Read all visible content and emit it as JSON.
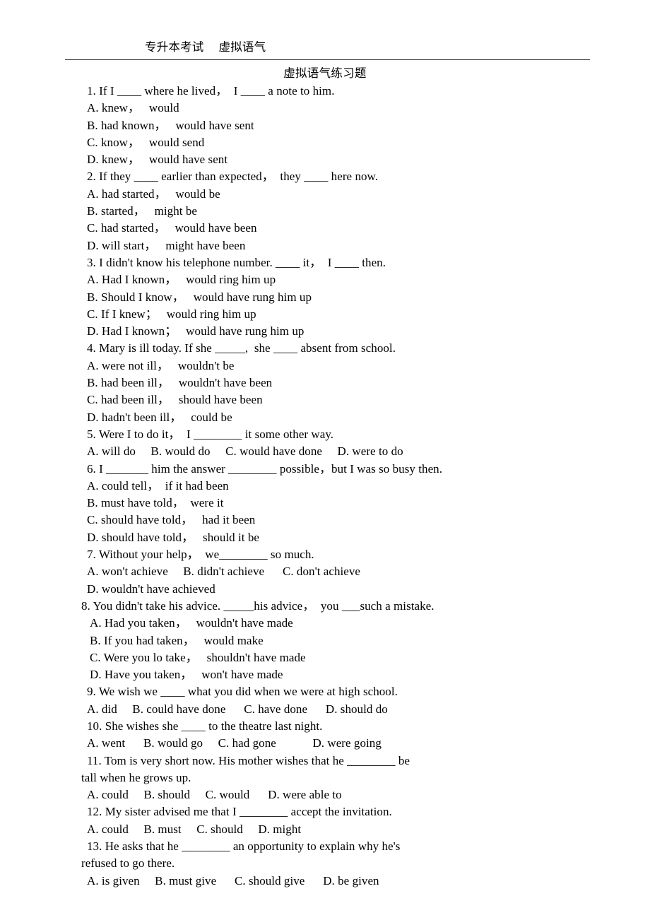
{
  "header": {
    "running_head": "专升本考试　 虚拟语气"
  },
  "title": "虚拟语气练习题",
  "lines": [
    {
      "id": "q1-stem",
      "text": "1. If I ____ where he lived，  I ____ a note to him."
    },
    {
      "id": "q1-a",
      "text": "A. knew，   would"
    },
    {
      "id": "q1-b",
      "text": "B. had known，   would have sent"
    },
    {
      "id": "q1-c",
      "text": "C. know，   would send"
    },
    {
      "id": "q1-d",
      "text": "D. knew，   would have sent"
    },
    {
      "id": "q2-stem",
      "text": "2. If they ____ earlier than expected，  they ____ here now."
    },
    {
      "id": "q2-a",
      "text": "A. had started，   would be"
    },
    {
      "id": "q2-b",
      "text": "B. started，   might be"
    },
    {
      "id": "q2-c",
      "text": "C. had started，   would have been"
    },
    {
      "id": "q2-d",
      "text": "D. will start，   might have been"
    },
    {
      "id": "q3-stem",
      "text": "3. I didn't know his telephone number. ____ it，  I ____ then."
    },
    {
      "id": "q3-a",
      "text": "A. Had I known，   would ring him up"
    },
    {
      "id": "q3-b",
      "text": "B. Should I know，   would have rung him up"
    },
    {
      "id": "q3-c",
      "text": "C. If I knew；   would ring him up"
    },
    {
      "id": "q3-d",
      "text": "D. Had I known；   would have rung him up"
    },
    {
      "id": "q4-stem",
      "text": "4. Mary is ill today. If she _____,  she ____ absent from school."
    },
    {
      "id": "q4-a",
      "text": "A. were not ill，   wouldn't be"
    },
    {
      "id": "q4-b",
      "text": "B. had been ill，   wouldn't have been"
    },
    {
      "id": "q4-c",
      "text": "C. had been ill，   should have been"
    },
    {
      "id": "q4-d",
      "text": "D. hadn't been ill，   could be"
    },
    {
      "id": "q5-stem",
      "text": "5. Were I to do it，  I ________ it some other way."
    },
    {
      "id": "q5-opts",
      "text": "A. will do     B. would do     C. would have done     D. were to do"
    },
    {
      "id": "q6-stem",
      "text": "6. I _______ him the answer ________ possible，but I was so busy then."
    },
    {
      "id": "q6-a",
      "text": "A. could tell，  if it had been"
    },
    {
      "id": "q6-b",
      "text": "B. must have told，  were it"
    },
    {
      "id": "q6-c",
      "text": "C. should have told，   had it been"
    },
    {
      "id": "q6-d",
      "text": "D. should have told，   should it be"
    },
    {
      "id": "q7-stem",
      "text": "7. Without your help，  we________ so much."
    },
    {
      "id": "q7-abc",
      "text": "A. won't achieve     B. didn't achieve      C. don't achieve"
    },
    {
      "id": "q7-d",
      "text": "D. wouldn't have achieved"
    },
    {
      "id": "q8-stem",
      "text": "8. You didn't take his advice. _____his advice，  you ___such a mistake."
    },
    {
      "id": "q8-a",
      "text": "A. Had you taken，   wouldn't have made"
    },
    {
      "id": "q8-b",
      "text": "B. If you had taken，   would make"
    },
    {
      "id": "q8-c",
      "text": "C. Were you lo take，   shouldn't have made"
    },
    {
      "id": "q8-d",
      "text": "D. Have you taken，   won't have made"
    },
    {
      "id": "q9-stem",
      "text": "9. We wish we ____ what you did when we were at high school."
    },
    {
      "id": "q9-opts",
      "text": "A. did     B. could have done      C. have done      D. should do"
    },
    {
      "id": "q10-stem",
      "text": "10. She wishes she ____ to the theatre last night."
    },
    {
      "id": "q10-opts",
      "text": "A. went      B. would go     C. had gone            D. were going"
    },
    {
      "id": "q11-stem",
      "text": "11. Tom is very short now. His mother wishes that he ________ be"
    },
    {
      "id": "q11-cont",
      "text": "tall when he grows up."
    },
    {
      "id": "q11-opts",
      "text": "A. could     B. should     C. would      D. were able to"
    },
    {
      "id": "q12-stem",
      "text": "12. My sister advised me that I ________ accept the invitation."
    },
    {
      "id": "q12-opts",
      "text": "A. could     B. must     C. should     D. might"
    },
    {
      "id": "q13-stem",
      "text": "13. He asks that he ________ an opportunity to explain why he's"
    },
    {
      "id": "q13-cont",
      "text": "refused to go there."
    },
    {
      "id": "q13-opts",
      "text": "A. is given     B. must give      C. should give      D. be given"
    }
  ],
  "line_styles": {
    "q8-stem": "outdent",
    "q8-a": "opt-indent",
    "q8-b": "opt-indent",
    "q8-c": "opt-indent",
    "q8-d": "opt-indent",
    "q11-cont": "wrap",
    "q13-cont": "wrap"
  },
  "colors": {
    "text": "#000000",
    "rule": "#3a3a3a",
    "background": "#ffffff"
  }
}
